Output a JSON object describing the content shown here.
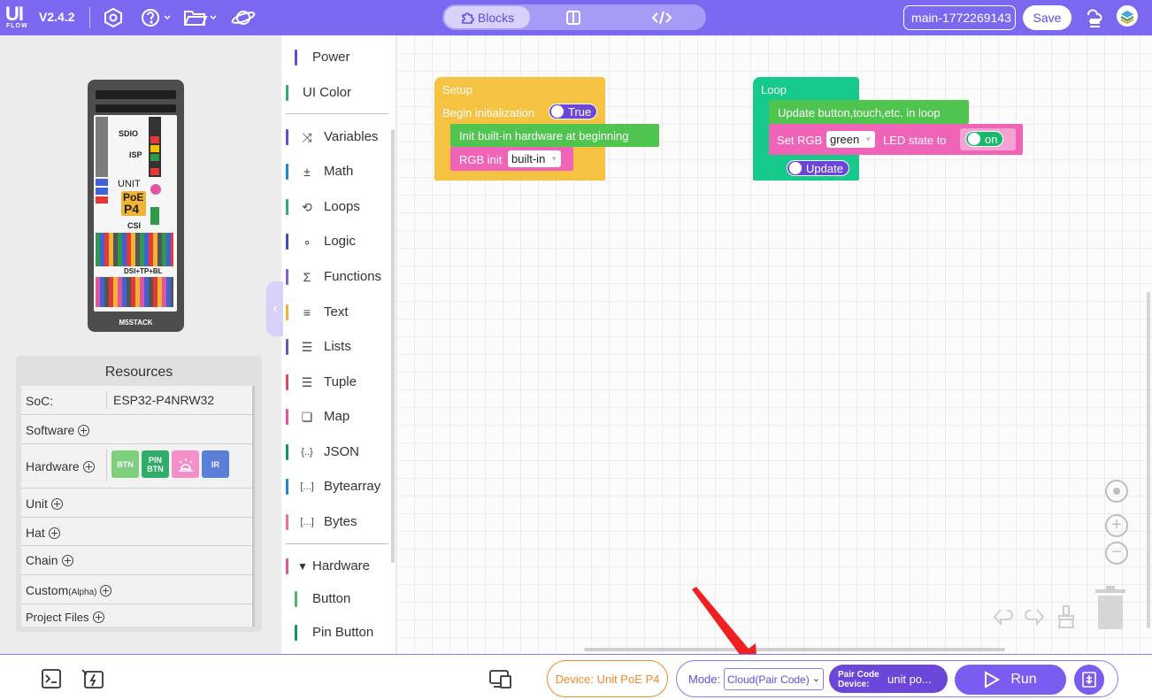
{
  "topbar": {
    "logo_ui": "UI",
    "logo_flow": "FLOW",
    "version": "V2.4.2",
    "icons": [
      "settings-icon",
      "help-icon",
      "folder-icon",
      "planet-icon"
    ],
    "tabs": [
      {
        "label": "Blocks",
        "icon": "puzzle-icon",
        "active": true
      },
      {
        "label": "",
        "icon": "split-view-icon",
        "active": false
      },
      {
        "label": "",
        "icon": "code-icon",
        "active": false
      }
    ],
    "filename": "main-1772269143",
    "save_label": "Save",
    "right_icons": [
      "cloud-stack-icon",
      "m5stack-icon"
    ]
  },
  "device": {
    "name_on_board": "M5STACK",
    "board_labels": [
      "SDIO",
      "ISP",
      "UNIT",
      "PoE",
      "P4",
      "CSI",
      "DSI+TP+BL"
    ]
  },
  "resources": {
    "title": "Resources",
    "soc_label": "SoC:",
    "soc_value": "ESP32-P4NRW32",
    "rows": [
      "Software",
      "Hardware",
      "Unit",
      "Hat",
      "Chain",
      "Custom",
      "Project Files"
    ],
    "custom_suffix": "(Alpha)",
    "hardware_badges": [
      {
        "label": "BTN",
        "color": "#7ed07e"
      },
      {
        "label": "PIN BTN",
        "color": "#2fae6a"
      },
      {
        "label": "",
        "icon": "rgb-light-icon",
        "color": "#f48fc9"
      },
      {
        "label": "IR",
        "color": "#5b7fd6"
      }
    ]
  },
  "toolbox": {
    "items": [
      {
        "label": "Power",
        "color": "#6c46d8",
        "icon": ""
      },
      {
        "label": "UI Color",
        "color": "#2fae6a",
        "icon": ""
      },
      {
        "label": "Variables",
        "color": "#6c46d8",
        "icon": "variables-icon"
      },
      {
        "label": "Math",
        "color": "#1e88c9",
        "icon": "math-icon"
      },
      {
        "label": "Loops",
        "color": "#2fae6a",
        "icon": "loops-icon"
      },
      {
        "label": "Logic",
        "color": "#3c4db0",
        "icon": "logic-icon"
      },
      {
        "label": "Functions",
        "color": "#8c5cc9",
        "icon": "functions-icon"
      },
      {
        "label": "Text",
        "color": "#f2b233",
        "icon": "text-icon"
      },
      {
        "label": "Lists",
        "color": "#5b60b6",
        "icon": "lists-icon"
      },
      {
        "label": "Tuple",
        "color": "#d94a5e",
        "icon": "tuple-icon"
      },
      {
        "label": "Map",
        "color": "#e0559e",
        "icon": "map-icon"
      },
      {
        "label": "JSON",
        "color": "#139468",
        "icon": "json-icon"
      },
      {
        "label": "Bytearray",
        "color": "#1e88c9",
        "icon": "bytearray-icon"
      },
      {
        "label": "Bytes",
        "color": "#f06ba8",
        "icon": "bytes-icon"
      },
      {
        "label": "Hardware",
        "color": "#e0559e",
        "icon": "caret-down-icon"
      },
      {
        "label": "Button",
        "color": "#4fb86a",
        "icon": ""
      },
      {
        "label": "Pin Button",
        "color": "#139468",
        "icon": ""
      }
    ],
    "icon_glyphs": {
      "variables": "⤨",
      "math": "±",
      "loops": "⟲",
      "logic": "∘",
      "functions": "Σ",
      "text": "≡",
      "lists": "☰",
      "tuple": "☰",
      "map": "❏",
      "json": "{..}",
      "bytearray": "[...]",
      "bytes": "[...]",
      "caret": "▼"
    }
  },
  "blocks": {
    "setup": {
      "hat": "Setup",
      "begin_label": "Begin initialization",
      "begin_toggle": "True",
      "init_label": "Init built-in hardware at beginning",
      "rgb_init_label": "RGB init",
      "rgb_init_value": "built-in"
    },
    "loop": {
      "hat": "Loop",
      "update_label": "Update button,touch,etc. in loop",
      "set_rgb_label": "Set RGB",
      "set_rgb_color": "green",
      "led_state_label": "LED state to",
      "led_state_value": "on",
      "update_toggle": "Update"
    },
    "colors": {
      "setup": "#f5c242",
      "loop": "#17c98b",
      "green": "#4fc44f",
      "pink": "#f064b8",
      "purple": "#6c46d8"
    }
  },
  "bottombar": {
    "terminal_icon": "terminal-icon",
    "flash_icon": "flash-icon",
    "device_manager_icon": "device-manager-icon",
    "device_label": "Device:",
    "device_value": "Unit PoE P4",
    "mode_label": "Mode:",
    "mode_value": "Cloud(Pair Code)",
    "pair_code_label": "Pair Code",
    "pair_device_label": "Device:",
    "pair_value": "unit po...",
    "run_label": "Run",
    "download_icon": "download-icon"
  },
  "annotation": {
    "color": "#f02020"
  }
}
